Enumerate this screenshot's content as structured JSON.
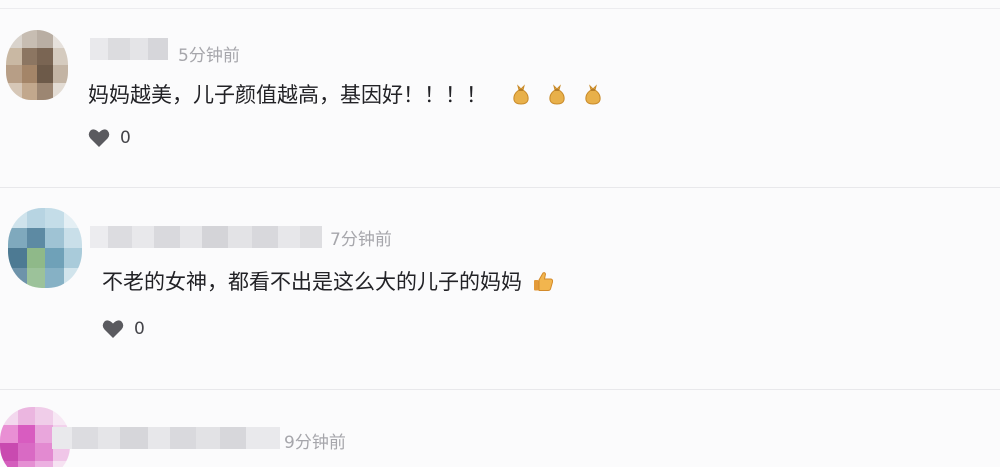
{
  "comments": [
    {
      "time": "5分钟前",
      "text": "妈妈越美，儿子颜值越高，基因好！！！！",
      "emojis": [
        "money-bag-emoji",
        "money-bag-emoji",
        "money-bag-emoji"
      ],
      "likes": "0"
    },
    {
      "time": "7分钟前",
      "text": "不老的女神，都看不出是这么大的儿子的妈妈",
      "emojis": [
        "thumbs-up-emoji"
      ],
      "likes": "0"
    },
    {
      "time": "9分钟前",
      "text": "",
      "emojis": [],
      "likes": ""
    }
  ],
  "colors": {
    "background": "#fbfbfc",
    "text": "#222226",
    "muted": "#a6a6ab",
    "heart": "#5a5a5f",
    "divider": "#e8e8eb"
  }
}
